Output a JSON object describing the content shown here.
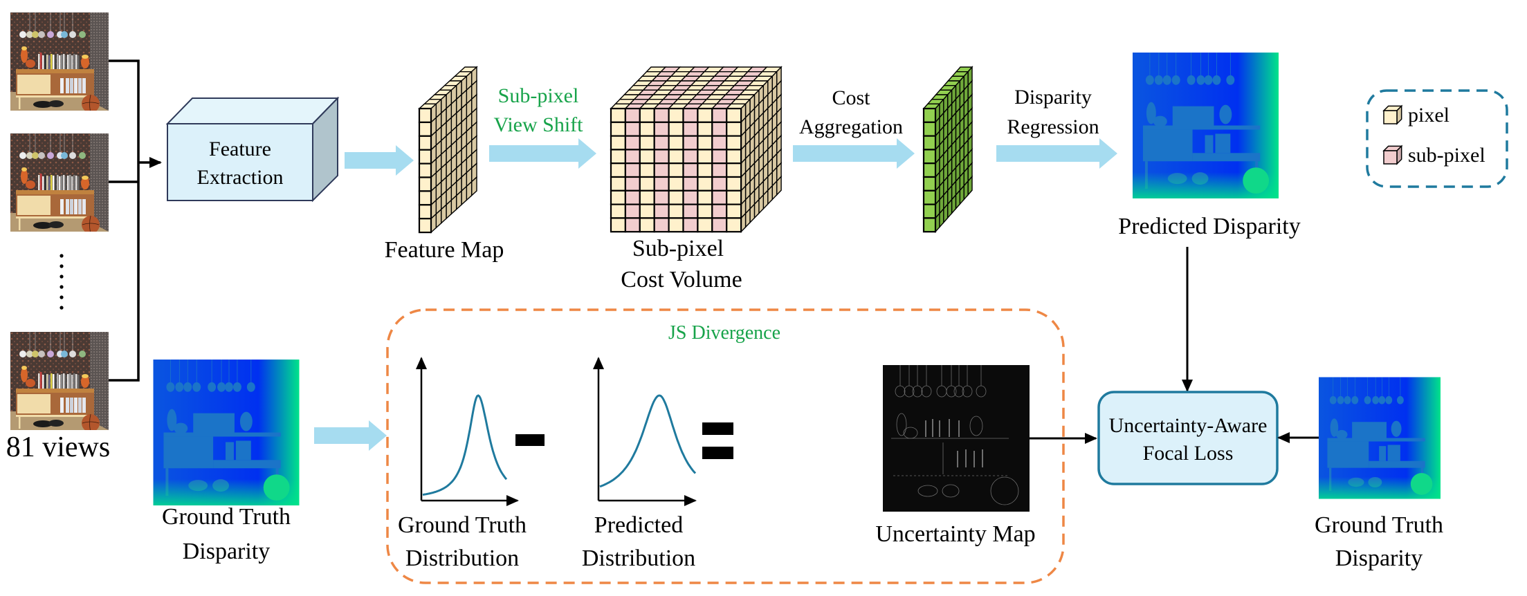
{
  "colors": {
    "arrow_fill": "#a6dcf0",
    "box_fill": "#dcf1fa",
    "box_side": "#b0c4cc",
    "box_stroke": "#2f3a5a",
    "pixel_cell": "#fff1cc",
    "pixel_side": "#d9c9a3",
    "subpixel_cell": "#f2cdce",
    "subpixel_side": "#cfaeaf",
    "agg_cell": "#92d050",
    "agg_side": "#6fa83a",
    "curve": "#1f7a9e",
    "dashed_orange": "#ee8745",
    "dashed_blue": "#1f7a9e",
    "focal_box_stroke": "#1f7a9e",
    "green_text": "#17a34a"
  },
  "inputs": {
    "views_label": "81 views",
    "views_count": 81
  },
  "pipeline": {
    "feature_extraction": {
      "line1": "Feature",
      "line2": "Extraction"
    },
    "feature_map_label": "Feature Map",
    "view_shift": {
      "line1": "Sub-pixel",
      "line2": "View Shift"
    },
    "cost_volume_label": {
      "line1": "Sub-pixel",
      "line2": "Cost Volume"
    },
    "cost_aggregation": {
      "line1": "Cost",
      "line2": "Aggregation"
    },
    "disparity_regression": {
      "line1": "Disparity",
      "line2": "Regression"
    },
    "predicted_disparity_label": "Predicted Disparity"
  },
  "legend": {
    "items": [
      {
        "label": "pixel",
        "kind": "pixel"
      },
      {
        "label": "sub-pixel",
        "kind": "subpixel"
      }
    ]
  },
  "loss": {
    "gt_disparity_label": {
      "line1": "Ground Truth",
      "line2": "Disparity"
    },
    "js_divergence_label": "JS Divergence",
    "gt_distribution_label": {
      "line1": "Ground Truth",
      "line2": "Distribution"
    },
    "pred_distribution_label": {
      "line1": "Predicted",
      "line2": "Distribution"
    },
    "uncertainty_map_label": "Uncertainty Map",
    "focal_loss": {
      "line1": "Uncertainty-Aware",
      "line2": "Focal Loss"
    },
    "gt_disparity_right_label": {
      "line1": "Ground Truth",
      "line2": "Disparity"
    }
  }
}
